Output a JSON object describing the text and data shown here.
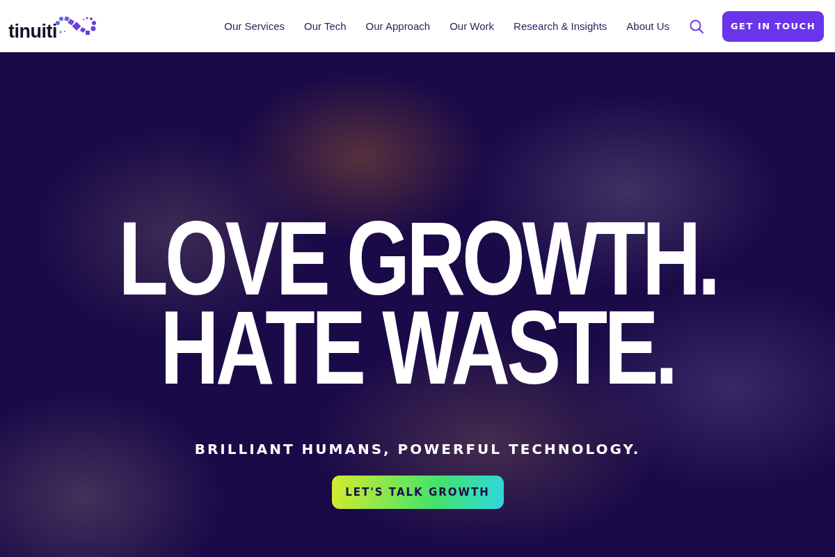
{
  "header": {
    "logo": "tinuiti",
    "nav": [
      {
        "label": "Our Services"
      },
      {
        "label": "Our Tech"
      },
      {
        "label": "Our Approach"
      },
      {
        "label": "Our Work"
      },
      {
        "label": "Research & Insights"
      },
      {
        "label": "About Us"
      }
    ],
    "cta": "GET IN TOUCH"
  },
  "hero": {
    "headline": [
      "LOVE GROWTH.",
      "HATE WASTE."
    ],
    "tagline": "BRILLIANT HUMANS, POWERFUL TECHNOLOGY.",
    "button": "LET'S TALK GROWTH"
  }
}
